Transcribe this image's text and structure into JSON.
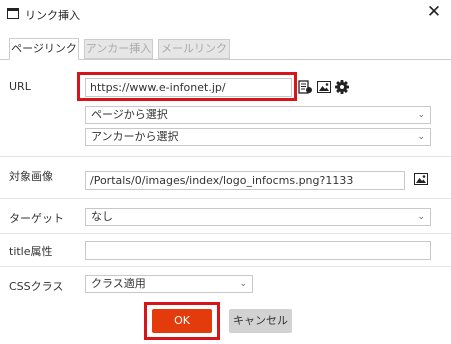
{
  "window": {
    "title": "リンク挿入",
    "close": "✕"
  },
  "tabs": [
    {
      "label": "ページリンク",
      "active": true
    },
    {
      "label": "アンカー挿入",
      "active": false
    },
    {
      "label": "メールリンク",
      "active": false
    }
  ],
  "form": {
    "url": {
      "label": "URL",
      "value": "https://www.e-infonet.jp/"
    },
    "page_select": {
      "value": "ページから選択"
    },
    "anchor_select": {
      "value": "アンカーから選択"
    },
    "image": {
      "label": "対象画像",
      "value": "/Portals/0/images/index/logo_infocms.png?1133"
    },
    "target": {
      "label": "ターゲット",
      "value": "なし"
    },
    "title_attr": {
      "label": "title属性",
      "value": ""
    },
    "css_class": {
      "label": "CSSクラス",
      "value": "クラス適用"
    }
  },
  "buttons": {
    "ok": "OK",
    "cancel": "キャンセル"
  },
  "colors": {
    "highlight": "#d6151b",
    "ok": "#e33b0c",
    "cancel": "#d2d2d2"
  },
  "icons": [
    "window-icon",
    "close-icon",
    "page-link-icon",
    "image-icon",
    "gear-icon",
    "chevron-down-icon"
  ]
}
